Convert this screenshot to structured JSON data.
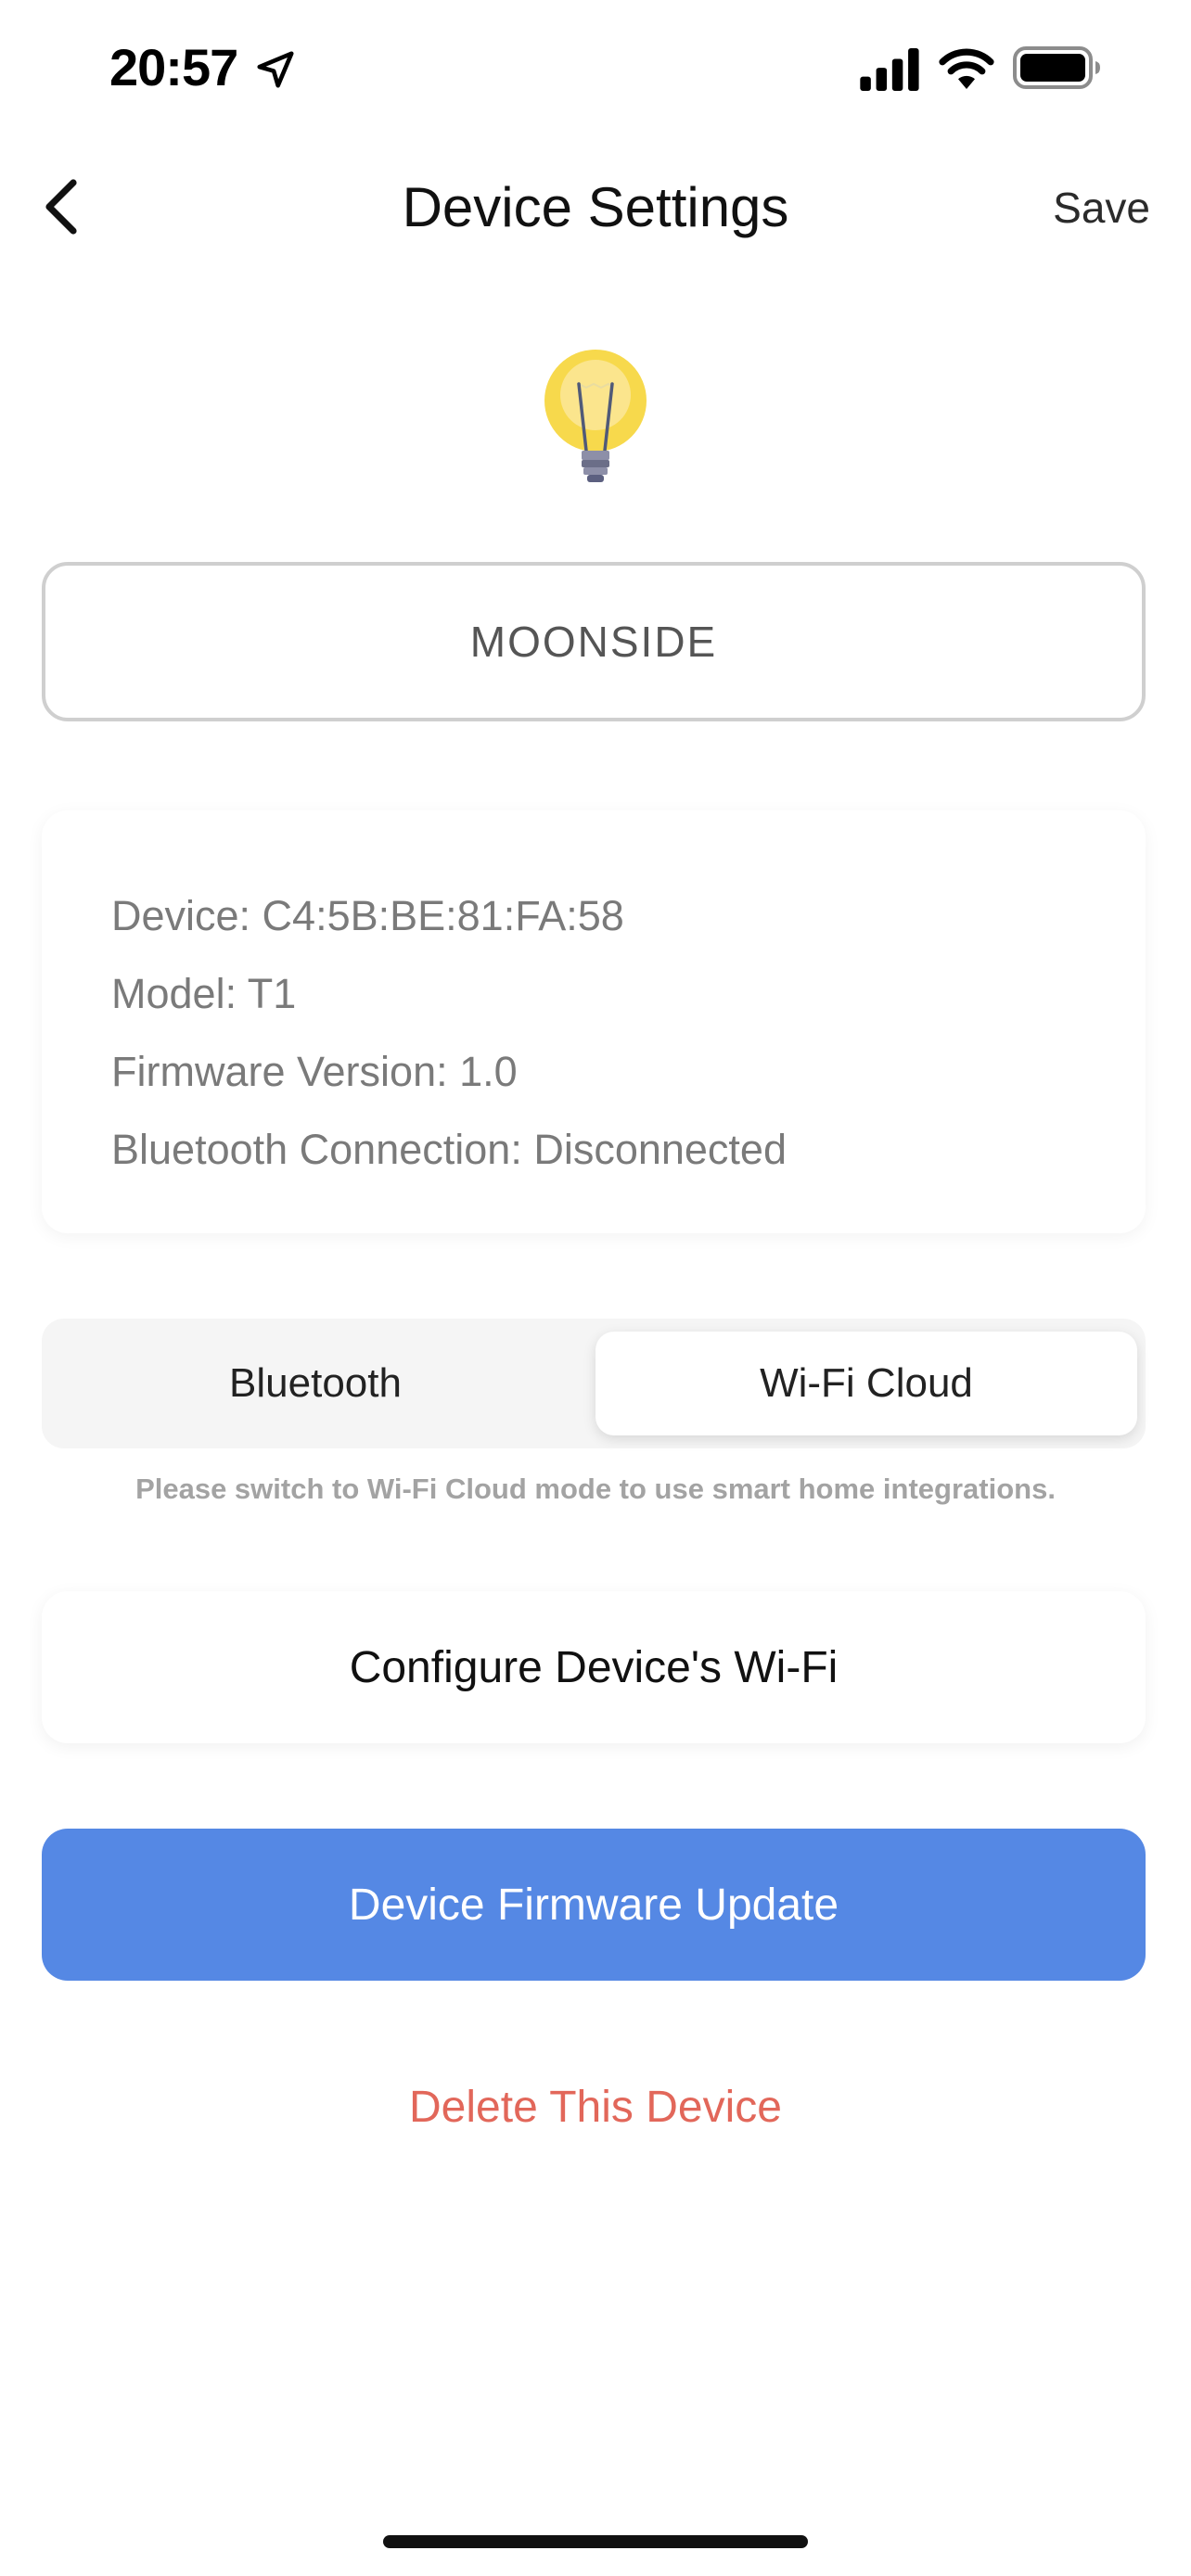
{
  "status_bar": {
    "time": "20:57",
    "icons": [
      "location-arrow-icon",
      "cellular-signal-icon",
      "wifi-icon",
      "battery-icon"
    ]
  },
  "nav": {
    "back_icon": "chevron-left-icon",
    "title": "Device Settings",
    "save_label": "Save"
  },
  "device": {
    "icon": "light-bulb-icon",
    "name_value": "MOONSIDE"
  },
  "info": {
    "device_line": "Device: C4:5B:BE:81:FA:58",
    "model_line": "Model: T1",
    "firmware_line": "Firmware Version: 1.0",
    "bluetooth_line": "Bluetooth Connection: Disconnected"
  },
  "mode": {
    "options": [
      "Bluetooth",
      "Wi-Fi Cloud"
    ],
    "selected": "Wi-Fi Cloud",
    "hint": "Please switch to Wi-Fi Cloud mode to use smart home integrations."
  },
  "actions": {
    "configure_wifi_label": "Configure Device's Wi-Fi",
    "firmware_update_label": "Device Firmware Update",
    "delete_label": "Delete This Device"
  },
  "colors": {
    "primary_button": "#5588e4",
    "danger_text": "#e2675a",
    "bulb_yellow": "#f7d94c"
  }
}
